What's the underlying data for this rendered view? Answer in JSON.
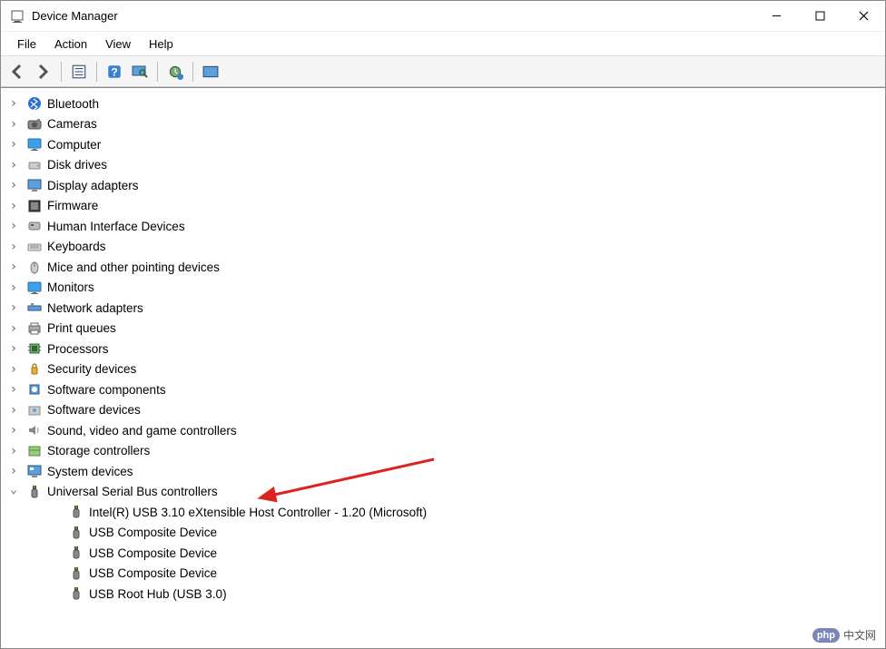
{
  "window": {
    "title": "Device Manager"
  },
  "menu": {
    "file": "File",
    "action": "Action",
    "view": "View",
    "help": "Help"
  },
  "tree": {
    "categories": [
      {
        "label": "Bluetooth",
        "icon": "bluetooth"
      },
      {
        "label": "Cameras",
        "icon": "camera"
      },
      {
        "label": "Computer",
        "icon": "monitor"
      },
      {
        "label": "Disk drives",
        "icon": "disk"
      },
      {
        "label": "Display adapters",
        "icon": "display"
      },
      {
        "label": "Firmware",
        "icon": "firmware"
      },
      {
        "label": "Human Interface Devices",
        "icon": "hid"
      },
      {
        "label": "Keyboards",
        "icon": "keyboard"
      },
      {
        "label": "Mice and other pointing devices",
        "icon": "mouse"
      },
      {
        "label": "Monitors",
        "icon": "monitor"
      },
      {
        "label": "Network adapters",
        "icon": "network"
      },
      {
        "label": "Print queues",
        "icon": "printer"
      },
      {
        "label": "Processors",
        "icon": "cpu"
      },
      {
        "label": "Security devices",
        "icon": "security"
      },
      {
        "label": "Software components",
        "icon": "software"
      },
      {
        "label": "Software devices",
        "icon": "software-dev"
      },
      {
        "label": "Sound, video and game controllers",
        "icon": "sound"
      },
      {
        "label": "Storage controllers",
        "icon": "storage"
      },
      {
        "label": "System devices",
        "icon": "system"
      },
      {
        "label": "Universal Serial Bus controllers",
        "icon": "usb",
        "expanded": true,
        "children": [
          {
            "label": "Intel(R) USB 3.10 eXtensible Host Controller - 1.20 (Microsoft)",
            "icon": "usb"
          },
          {
            "label": "USB Composite Device",
            "icon": "usb"
          },
          {
            "label": "USB Composite Device",
            "icon": "usb"
          },
          {
            "label": "USB Composite Device",
            "icon": "usb"
          },
          {
            "label": "USB Root Hub (USB 3.0)",
            "icon": "usb"
          }
        ]
      }
    ]
  },
  "watermark": {
    "badge": "php",
    "text": "中文网"
  }
}
